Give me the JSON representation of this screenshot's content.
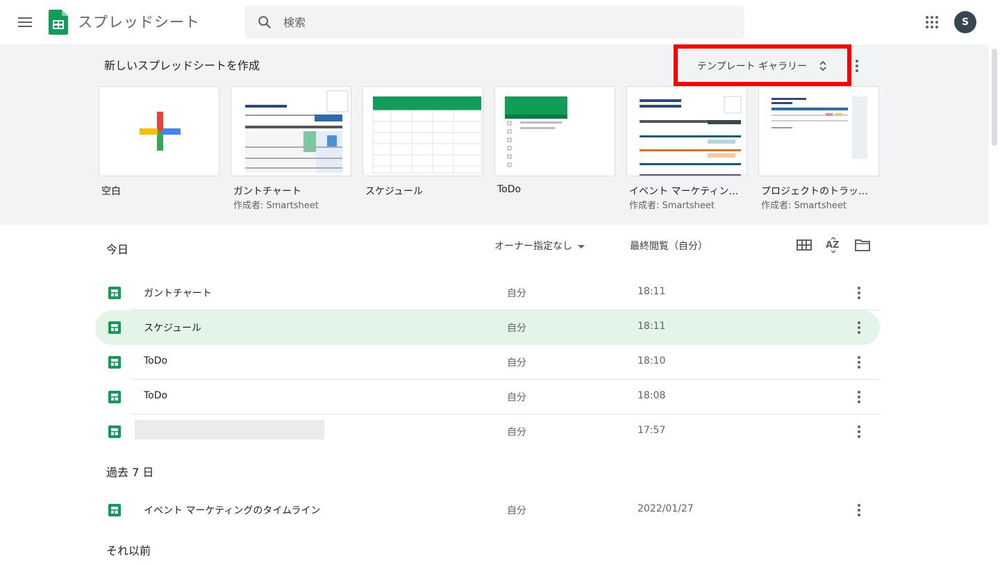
{
  "header": {
    "app_title": "スプレッドシート",
    "search_placeholder": "検索",
    "avatar_letter": "S"
  },
  "templates": {
    "section_title": "新しいスプレッドシートを作成",
    "gallery_label": "テンプレート ギャラリー",
    "items": [
      {
        "name": "空白",
        "author": ""
      },
      {
        "name": "ガントチャート",
        "author": "作成者: Smartsheet"
      },
      {
        "name": "スケジュール",
        "author": ""
      },
      {
        "name": "ToDo",
        "author": ""
      },
      {
        "name": "イベント マーケティン…",
        "author": "作成者: Smartsheet"
      },
      {
        "name": "プロジェクトのトラッ…",
        "author": "作成者: Smartsheet"
      }
    ]
  },
  "list": {
    "header_title": "今日",
    "owner_filter": "オーナー指定なし",
    "sort_label": "最終閲覧（自分）",
    "today_rows": [
      {
        "name": "ガントチャート",
        "owner": "自分",
        "time": "18:11"
      },
      {
        "name": "スケジュール",
        "owner": "自分",
        "time": "18:11"
      },
      {
        "name": "ToDo",
        "owner": "自分",
        "time": "18:10"
      },
      {
        "name": "ToDo",
        "owner": "自分",
        "time": "18:08"
      },
      {
        "name": "",
        "owner": "自分",
        "time": "17:57"
      }
    ],
    "past7_label": "過去 7 日",
    "past7_rows": [
      {
        "name": "イベント マーケティングのタイムライン",
        "owner": "自分",
        "time": "2022/01/27"
      }
    ],
    "earlier_label": "それ以前"
  },
  "colors": {
    "sheets_green": "#0f9d58",
    "highlight_red": "#ff0000",
    "selected_row": "#e3f4e8"
  }
}
